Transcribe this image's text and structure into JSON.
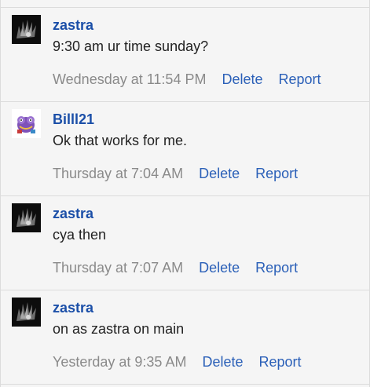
{
  "messages": [
    {
      "author": "zastra",
      "avatar_icon": "dark-spiky-avatar-icon",
      "text": "9:30 am ur time sunday?",
      "time": "Wednesday at 11:54 PM",
      "delete_label": "Delete",
      "report_label": "Report"
    },
    {
      "author": "Billl21",
      "avatar_icon": "purple-character-avatar-icon",
      "text": "Ok that works for me.",
      "time": "Thursday at 7:04 AM",
      "delete_label": "Delete",
      "report_label": "Report"
    },
    {
      "author": "zastra",
      "avatar_icon": "dark-spiky-avatar-icon",
      "text": "cya then",
      "time": "Thursday at 7:07 AM",
      "delete_label": "Delete",
      "report_label": "Report"
    },
    {
      "author": "zastra",
      "avatar_icon": "dark-spiky-avatar-icon",
      "text": "on as zastra on main",
      "time": "Yesterday at 9:35 AM",
      "delete_label": "Delete",
      "report_label": "Report"
    }
  ],
  "colors": {
    "author": "#1b4fa8",
    "link": "#2b60b8",
    "timestamp": "#8a8a8a",
    "background": "#f5f5f5"
  }
}
